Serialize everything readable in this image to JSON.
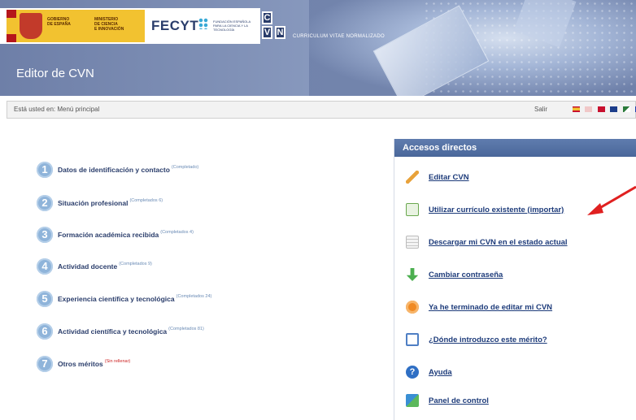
{
  "header": {
    "gov_line1": "GOBIERNO\nDE ESPAÑA",
    "gov_line2": "MINISTERIO\nDE CIENCIA\nE INNOVACIÓN",
    "fecyt": "FECYT",
    "fecyt_sub": "FUNDACIÓN ESPAÑOLA PARA LA CIENCIA Y LA TECNOLOGÍA",
    "cvn_letters": [
      "C",
      "V",
      "N"
    ],
    "tagline": "CURRICULUM VITAE NORMALIZADO",
    "app_title": "Editor de CVN"
  },
  "crumb": {
    "label": "Está usted en: Menú principal",
    "salir": "Salir",
    "flag_colors": [
      "#e8c020",
      "#c8102e",
      "#f0b000",
      "#1c3d8a",
      "#2a7a3a",
      "#1d3bb0"
    ]
  },
  "menu": {
    "items": [
      {
        "num": "1",
        "title": "Datos de identificación y contacto",
        "status": "(Completado)",
        "status_color": "blue"
      },
      {
        "num": "2",
        "title": "Situación profesional",
        "status": "(Completados 6)",
        "status_color": "blue"
      },
      {
        "num": "3",
        "title": "Formación académica recibida",
        "status": "(Completados 4)",
        "status_color": "blue"
      },
      {
        "num": "4",
        "title": "Actividad docente",
        "status": "(Completados 9)",
        "status_color": "blue"
      },
      {
        "num": "5",
        "title": "Experiencia científica y tecnológica",
        "status": "(Completados 24)",
        "status_color": "blue"
      },
      {
        "num": "6",
        "title": "Actividad científica y tecnológica",
        "status": "(Completados 81)",
        "status_color": "blue"
      },
      {
        "num": "7",
        "title": "Otros méritos",
        "status": "(Sin rellenar)",
        "status_color": "red"
      }
    ]
  },
  "panel": {
    "title": "Accesos directos",
    "links": [
      {
        "label": "Editar CVN",
        "icon": "pencil-icon",
        "color": "#e8a23a"
      },
      {
        "label": "Utilizar currículo existente (importar)",
        "icon": "import-icon",
        "color": "#6aa84f"
      },
      {
        "label": "Descargar mi CVN en el estado actual",
        "icon": "document-icon",
        "color": "#d8d8d8"
      },
      {
        "label": "Cambiar contraseña",
        "icon": "green-arrow-icon",
        "color": "#4caf50"
      },
      {
        "label": "Ya he terminado de editar mi CVN",
        "icon": "stop-icon",
        "color": "#f08a24"
      },
      {
        "label": "¿Dónde introduzco este mérito?",
        "icon": "help-doc-icon",
        "color": "#4f7fc4"
      },
      {
        "label": "Ayuda",
        "icon": "question-icon",
        "color": "#2f6fc4"
      },
      {
        "label": "Panel de control",
        "icon": "control-panel-icon",
        "color": "#3a8fd4"
      }
    ]
  },
  "annotation": {
    "arrow_color": "#e02020"
  }
}
